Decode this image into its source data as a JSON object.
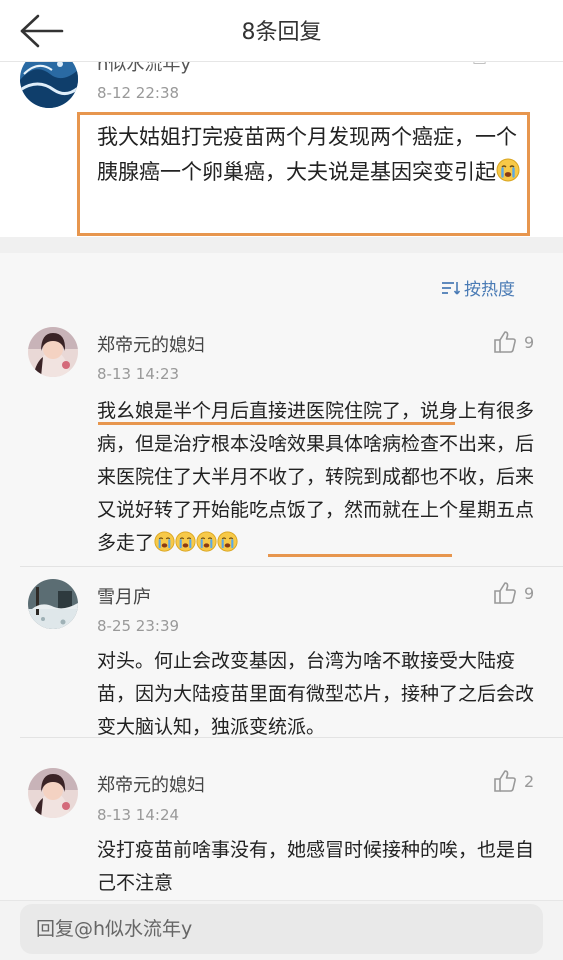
{
  "header": {
    "title": "8条回复"
  },
  "root_comment": {
    "user": "h似水流年y",
    "time": "8-12 22:38",
    "text": "我大姑姐打完疫苗两个月发现两个癌症，一个胰腺癌一个卵巢癌，大夫说是基因突变引起"
  },
  "sort": {
    "label": "按热度"
  },
  "comments": [
    {
      "user": "郑帝元的媳妇",
      "time": "8-13 14:23",
      "likes": "9",
      "text_a": "我幺娘是半个月后直接进医院住院了",
      "text_b": "，说身上有很多病，但是治疗根本没啥效果具体啥病检查不出来，后来医院住了大半月不收了，转院到成都也不收，后来又说好转了开始能吃点饭了，然而就在上个",
      "text_c": "星期五点多走了",
      "avatar": "girl-avatar"
    },
    {
      "user": "雪月庐",
      "time": "8-25 23:39",
      "likes": "9",
      "text": "对头。何止会改变基因，台湾为啥不敢接受大陆疫苗，因为大陆疫苗里面有微型芯片，接种了之后会改变大脑认知，独派变统派。",
      "avatar": "winter-scene-avatar"
    },
    {
      "user": "郑帝元的媳妇",
      "time": "8-13 14:24",
      "likes": "2",
      "text": "没打疫苗前啥事没有，她感冒时候接种的唉，也是自己不注意",
      "avatar": "girl-avatar"
    }
  ],
  "reply": {
    "placeholder": "回复@h似水流年y"
  },
  "colors": {
    "highlight": "#e7964e",
    "link": "#4a7bb5",
    "background": "#f7f7f7"
  }
}
